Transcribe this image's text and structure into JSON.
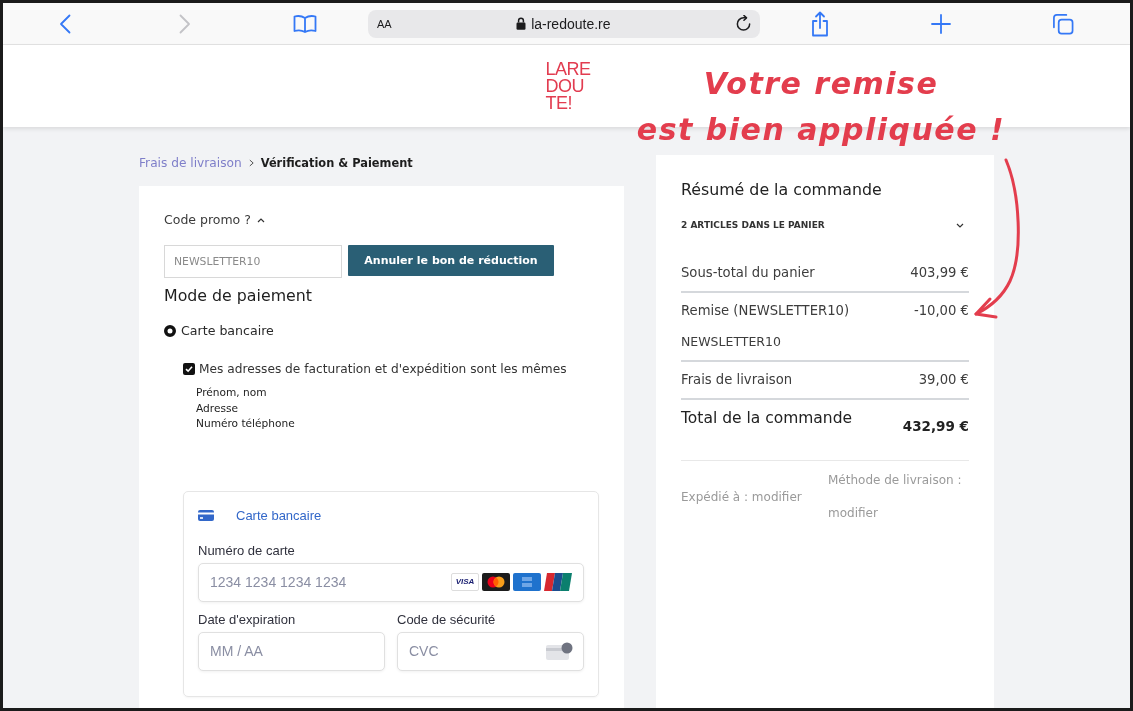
{
  "browser": {
    "reader_label": "AA",
    "url": "la-redoute.re",
    "back_enabled": true,
    "forward_enabled": false
  },
  "logo": {
    "lines": [
      "LARE",
      "DOU",
      "TE!"
    ]
  },
  "annotation": {
    "lines": [
      "Votre remise",
      "est bien appliquée !"
    ]
  },
  "breadcrumb": [
    {
      "label": "Frais de livraison",
      "selected": false
    },
    {
      "label": "Vérification & Paiement",
      "selected": true
    }
  ],
  "promo": {
    "label": "Code promo ?",
    "expanded": true,
    "value": "NEWSLETTER10",
    "disabled": true,
    "button": "Annuler le bon de réduction"
  },
  "payment": {
    "title": "Mode de paiement",
    "methods": [
      {
        "label": "Carte bancaire",
        "selected": true
      }
    ],
    "same_address": {
      "label": "Mes adresses de facturation et d'expédition sont les mêmes",
      "checked": true
    },
    "address_lines": [
      "Prénom, nom",
      "Adresse",
      "Numéro téléphone"
    ]
  },
  "card_form": {
    "title": "Carte bancaire",
    "fields": [
      {
        "kind": "number",
        "label": "Numéro de carte",
        "placeholder": "1234 1234 1234 1234"
      },
      {
        "kind": "expiry",
        "label": "Date d'expiration",
        "placeholder": "MM / AA"
      },
      {
        "kind": "cvc",
        "label": "Code de sécurité",
        "placeholder": "CVC"
      }
    ],
    "brands": [
      {
        "kind": "visa",
        "text": "VISA"
      },
      {
        "kind": "mastercard"
      },
      {
        "kind": "amex"
      },
      {
        "kind": "unionpay"
      }
    ]
  },
  "summary": {
    "title": "Résumé de la commande",
    "items_toggle": {
      "label": "2 ARTICLES DANS LE PANIER",
      "expanded": false
    },
    "lines": [
      {
        "kind": "line",
        "label": "Sous-total du panier",
        "value": "403,99 €"
      },
      {
        "kind": "discount",
        "label": "Remise (NEWSLETTER10)",
        "value": "-10,00 €",
        "code": "NEWSLETTER10"
      },
      {
        "kind": "line",
        "label": "Frais de livraison",
        "value": "39,00 €"
      },
      {
        "kind": "total",
        "label": "Total de la commande",
        "value": "432,99 €"
      }
    ],
    "shipped_to": "Expédié à : modifier",
    "shipping_method": "Méthode de livraison : modifier"
  }
}
